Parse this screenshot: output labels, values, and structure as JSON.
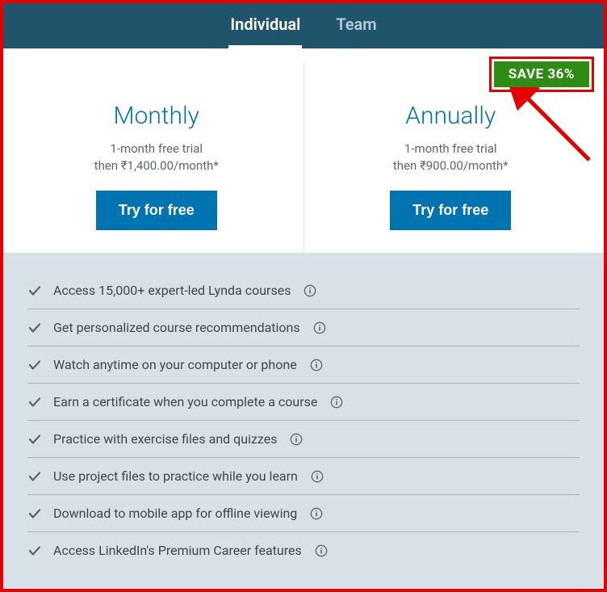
{
  "tabs": {
    "individual": "Individual",
    "team": "Team"
  },
  "plans": {
    "monthly": {
      "title": "Monthly",
      "trial": "1-month free trial",
      "price_line": "then ₹1,400.00/month*",
      "cta": "Try for free"
    },
    "annually": {
      "title": "Annually",
      "trial": "1-month free trial",
      "price_line": "then ₹900.00/month*",
      "cta": "Try for free",
      "badge": "SAVE 36%"
    }
  },
  "features": [
    "Access 15,000+ expert-led Lynda courses",
    "Get personalized course recommendations",
    "Watch anytime on your computer or phone",
    "Earn a certificate when you complete a course",
    "Practice with exercise files and quizzes",
    "Use project files to practice while you learn",
    "Download to mobile app for offline viewing",
    "Access LinkedIn's Premium Career features"
  ]
}
